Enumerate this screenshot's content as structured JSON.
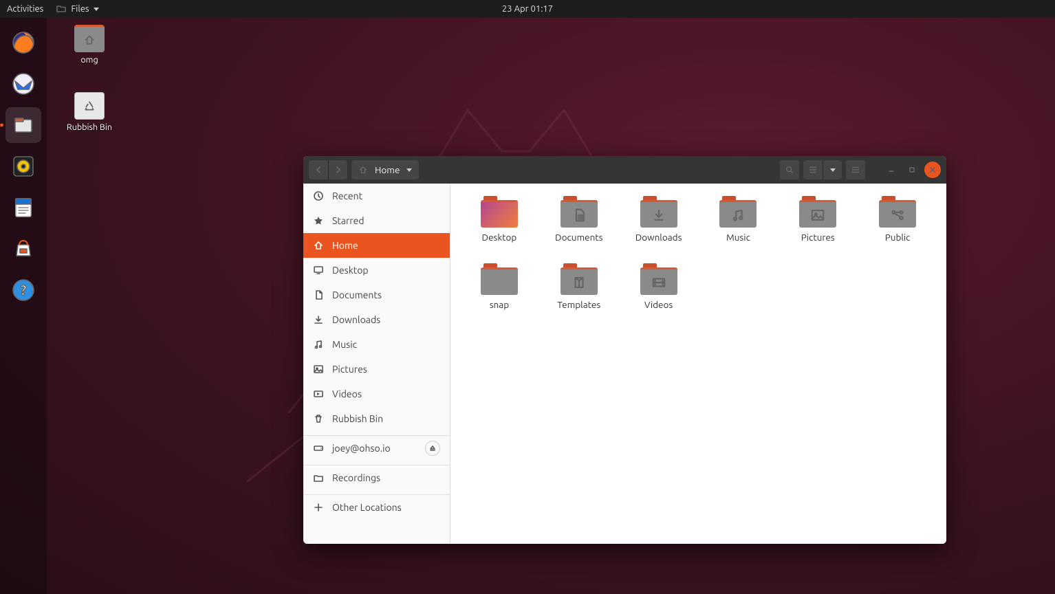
{
  "topbar": {
    "activities": "Activities",
    "app_name": "Files",
    "datetime": "23 Apr  01:17"
  },
  "dock": {
    "items": [
      {
        "name": "firefox-icon",
        "color": "#ff7c1f"
      },
      {
        "name": "thunderbird-icon",
        "color": "#1f6fff"
      },
      {
        "name": "files-icon",
        "color": "#e6e6e6",
        "active": true
      },
      {
        "name": "rhythmbox-icon",
        "color": "#f2c200"
      },
      {
        "name": "libreoffice-writer-icon",
        "color": "#1873d3"
      },
      {
        "name": "ubuntu-software-icon",
        "color": "#e95420"
      },
      {
        "name": "help-icon",
        "color": "#2f8fe0"
      }
    ]
  },
  "desktop_icons": [
    {
      "label": "omg",
      "kind": "home-folder"
    },
    {
      "label": "Rubbish Bin",
      "kind": "trash"
    }
  ],
  "files_window": {
    "path_label": "Home",
    "sidebar": [
      {
        "icon": "clock-icon",
        "label": "Recent"
      },
      {
        "icon": "star-icon",
        "label": "Starred"
      },
      {
        "icon": "home-icon",
        "label": "Home",
        "selected": true
      },
      {
        "icon": "desktop-icon",
        "label": "Desktop"
      },
      {
        "icon": "documents-icon",
        "label": "Documents"
      },
      {
        "icon": "downloads-icon",
        "label": "Downloads"
      },
      {
        "icon": "music-icon",
        "label": "Music"
      },
      {
        "icon": "pictures-icon",
        "label": "Pictures"
      },
      {
        "icon": "videos-icon",
        "label": "Videos"
      },
      {
        "icon": "trash-icon",
        "label": "Rubbish Bin"
      },
      {
        "sep": true
      },
      {
        "icon": "drive-icon",
        "label": "joey@ohso.io",
        "eject": true
      },
      {
        "sep": true
      },
      {
        "icon": "folder-icon",
        "label": "Recordings"
      },
      {
        "sep": true
      },
      {
        "icon": "plus-icon",
        "label": "Other Locations"
      }
    ],
    "items": [
      {
        "label": "Desktop",
        "glyph": "desktop"
      },
      {
        "label": "Documents",
        "glyph": "documents"
      },
      {
        "label": "Downloads",
        "glyph": "downloads"
      },
      {
        "label": "Music",
        "glyph": "music"
      },
      {
        "label": "Pictures",
        "glyph": "pictures"
      },
      {
        "label": "Public",
        "glyph": "public"
      },
      {
        "label": "snap",
        "glyph": "plain"
      },
      {
        "label": "Templates",
        "glyph": "templates"
      },
      {
        "label": "Videos",
        "glyph": "videos"
      }
    ]
  }
}
